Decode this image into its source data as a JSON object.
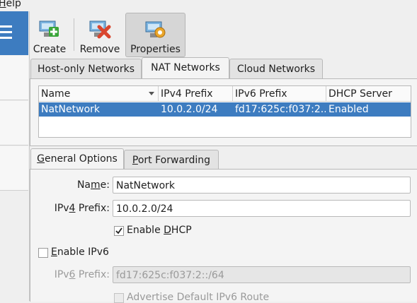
{
  "menu": {
    "help_label": "Help"
  },
  "toolbar": {
    "create_label": "Create",
    "remove_label": "Remove",
    "properties_label": "Properties"
  },
  "network_tabs": [
    {
      "label": "Host-only Networks"
    },
    {
      "label": "NAT Networks"
    },
    {
      "label": "Cloud Networks"
    }
  ],
  "table": {
    "columns": [
      "Name",
      "IPv4 Prefix",
      "IPv6 Prefix",
      "DHCP Server"
    ],
    "rows": [
      {
        "name": "NatNetwork",
        "ipv4": "10.0.2.0/24",
        "ipv6": "fd17:625c:f037:2...",
        "dhcp": "Enabled"
      }
    ]
  },
  "detail_tabs": [
    {
      "label": "General Options"
    },
    {
      "label": "Port Forwarding"
    }
  ],
  "form": {
    "name_label": "Name:",
    "name_value": "NatNetwork",
    "ipv4_label": "IPv4 Prefix:",
    "ipv4_value": "10.0.2.0/24",
    "enable_dhcp_label": "Enable DHCP",
    "enable_dhcp_checked": true,
    "enable_ipv6_label": "Enable IPv6",
    "enable_ipv6_checked": false,
    "ipv6_label": "IPv6 Prefix:",
    "ipv6_value": "fd17:625c:f037:2::/64",
    "advertise_label": "Advertise Default IPv6 Route"
  },
  "colors": {
    "selection": "#3d7cc0"
  },
  "icons": [
    "create-network-icon",
    "remove-network-icon",
    "properties-network-icon",
    "menu-icon",
    "sort-arrow-icon",
    "checkmark-icon"
  ]
}
